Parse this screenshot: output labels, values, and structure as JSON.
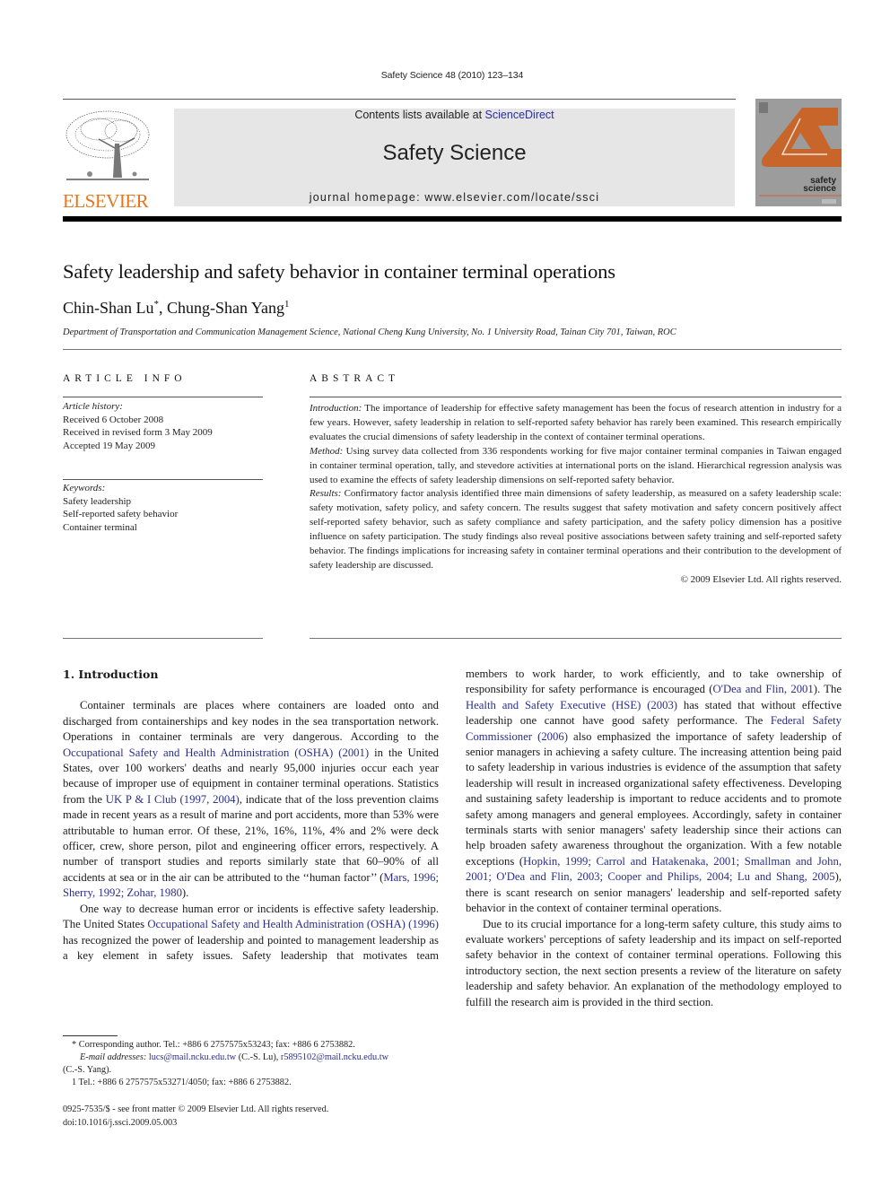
{
  "running_head": "Safety Science 48 (2010) 123–134",
  "banner": {
    "contents_prefix": "Contents lists available at ",
    "contents_link": "ScienceDirect",
    "journal_title": "Safety Science",
    "homepage": "journal homepage: www.elsevier.com/locate/ssci"
  },
  "publisher_logo": {
    "wordmark": "ELSEVIER",
    "color": "#e8761c"
  },
  "cover": {
    "title_line1": "safety",
    "title_line2": "science",
    "accent_color": "#c8652a"
  },
  "article": {
    "title": "Safety leadership and safety behavior in container terminal operations",
    "author1": "Chin-Shan Lu",
    "author1_mark": "*",
    "separator": ", ",
    "author2": "Chung-Shan Yang",
    "author2_mark": "1",
    "affiliation": "Department of Transportation and Communication Management Science, National Cheng Kung University, No. 1 University Road, Tainan City 701, Taiwan, ROC"
  },
  "article_info": {
    "heading": "ARTICLE INFO",
    "history_label": "Article history:",
    "history": [
      "Received 6 October 2008",
      "Received in revised form 3 May 2009",
      "Accepted 19 May 2009"
    ],
    "keywords_label": "Keywords:",
    "keywords": [
      "Safety leadership",
      "Self-reported safety behavior",
      "Container terminal"
    ]
  },
  "abstract": {
    "heading": "ABSTRACT",
    "sections": [
      {
        "label": "Introduction:",
        "text": " The importance of leadership for effective safety management has been the focus of research attention in industry for a few years. However, safety leadership in relation to self-reported safety behavior has rarely been examined. This research empirically evaluates the crucial dimensions of safety leadership in the context of container terminal operations."
      },
      {
        "label": "Method:",
        "text": " Using survey data collected from 336 respondents working for five major container terminal companies in Taiwan engaged in container terminal operation, tally, and stevedore activities at international ports on the island. Hierarchical regression analysis was used to examine the effects of safety leadership dimensions on self-reported safety behavior."
      },
      {
        "label": "Results:",
        "text": " Confirmatory factor analysis identified three main dimensions of safety leadership, as measured on a safety leadership scale: safety motivation, safety policy, and safety concern. The results suggest that safety motivation and safety concern positively affect self-reported safety behavior, such as safety compliance and safety participation, and the safety policy dimension has a positive influence on safety participation. The study findings also reveal positive associations between safety training and self-reported safety behavior. The findings implications for increasing safety in container terminal operations and their contribution to the development of safety leadership are discussed."
      }
    ],
    "copyright": "© 2009 Elsevier Ltd. All rights reserved."
  },
  "body": {
    "section_heading": "1. Introduction",
    "p1": [
      {
        "t": "Container terminals are places where containers are loaded onto and discharged from containerships and key nodes in the sea transportation network. Operations in container terminals are very dangerous. According to the "
      },
      {
        "c": "Occupational Safety and Health Administration (OSHA) (2001)"
      },
      {
        "t": " in the United States, over 100 workers' deaths and nearly 95,000 injuries occur each year because of improper use of equipment in container terminal operations. Statistics from the "
      },
      {
        "c": "UK P & I Club (1997, 2004)"
      },
      {
        "t": ", indicate that of the loss prevention claims made in recent years as a result of marine and port accidents, more than 53% were attributable to human error. Of these, 21%, 16%, 11%, 4% and 2% were deck officer, crew, shore person, pilot and engineering officer errors, respectively. A number of transport studies and reports similarly state that 60–90% of all accidents at sea or in the air can be attributed to the ‘‘human factor’’ ("
      },
      {
        "c": "Mars, 1996; Sherry, 1992; Zohar, 1980"
      },
      {
        "t": ")."
      }
    ],
    "p2": [
      {
        "t": "One way to decrease human error or incidents is effective safety leadership. The United States "
      },
      {
        "c": "Occupational Safety and Health Administration (OSHA) (1996)"
      },
      {
        "t": " has recognized the power of leadership and pointed to management leadership as a key element in safety issues. Safety leadership that motivates team members to work harder, to work efficiently, and to take ownership of responsibility for safety performance is encouraged ("
      },
      {
        "c": "O'Dea and Flin, 2001"
      },
      {
        "t": "). The "
      },
      {
        "c": "Health and Safety Executive (HSE) (2003)"
      },
      {
        "t": " has stated that without effective leadership one cannot have good safety performance. The "
      },
      {
        "c": "Federal Safety Commissioner (2006)"
      },
      {
        "t": " also emphasized the importance of safety leadership of senior managers in achieving a safety culture. The increasing attention being paid to safety leadership in various industries is evidence of the assumption that safety leadership will result in increased organizational safety effectiveness. Developing and sustaining safety leadership is important to reduce accidents and to promote safety among managers and general employees. Accordingly, safety in container terminals starts with senior managers' safety leadership since their actions can help broaden safety awareness throughout the organization. With a few notable exceptions ("
      },
      {
        "c": "Hopkin, 1999; Carrol and Hatakenaka, 2001; Smallman and John, 2001; O'Dea and Flin, 2003; Cooper and Philips, 2004; Lu and Shang, 2005"
      },
      {
        "t": "), there is scant research on senior managers' leadership and self-reported safety behavior in the context of container terminal operations."
      }
    ],
    "p3": [
      {
        "t": "Due to its crucial importance for a long-term safety culture, this study aims to evaluate workers' perceptions of safety leadership and its impact on self-reported safety behavior in the context of container terminal operations. Following this introductory section, the next section presents a review of the literature on safety leadership and safety behavior. An explanation of the methodology employed to fulfill the research aim is provided in the third section."
      }
    ]
  },
  "footnotes": {
    "corresponding": "*  Corresponding author. Tel.: +886 6 2757575x53243; fax: +886 6 2753882.",
    "email_label": "E-mail addresses:",
    "email1": "lucs@mail.ncku.edu.tw",
    "email1_owner": " (C.-S. Lu), ",
    "email2": "r5895102@mail.ncku.edu.tw",
    "email2_owner": "(C.-S. Yang).",
    "note1": "1  Tel.: +886 6 2757575x53271/4050; fax: +886 6 2753882."
  },
  "front_matter": {
    "issn_line": "0925-7535/$ - see front matter © 2009 Elsevier Ltd. All rights reserved.",
    "doi": "doi:10.1016/j.ssci.2009.05.003"
  }
}
